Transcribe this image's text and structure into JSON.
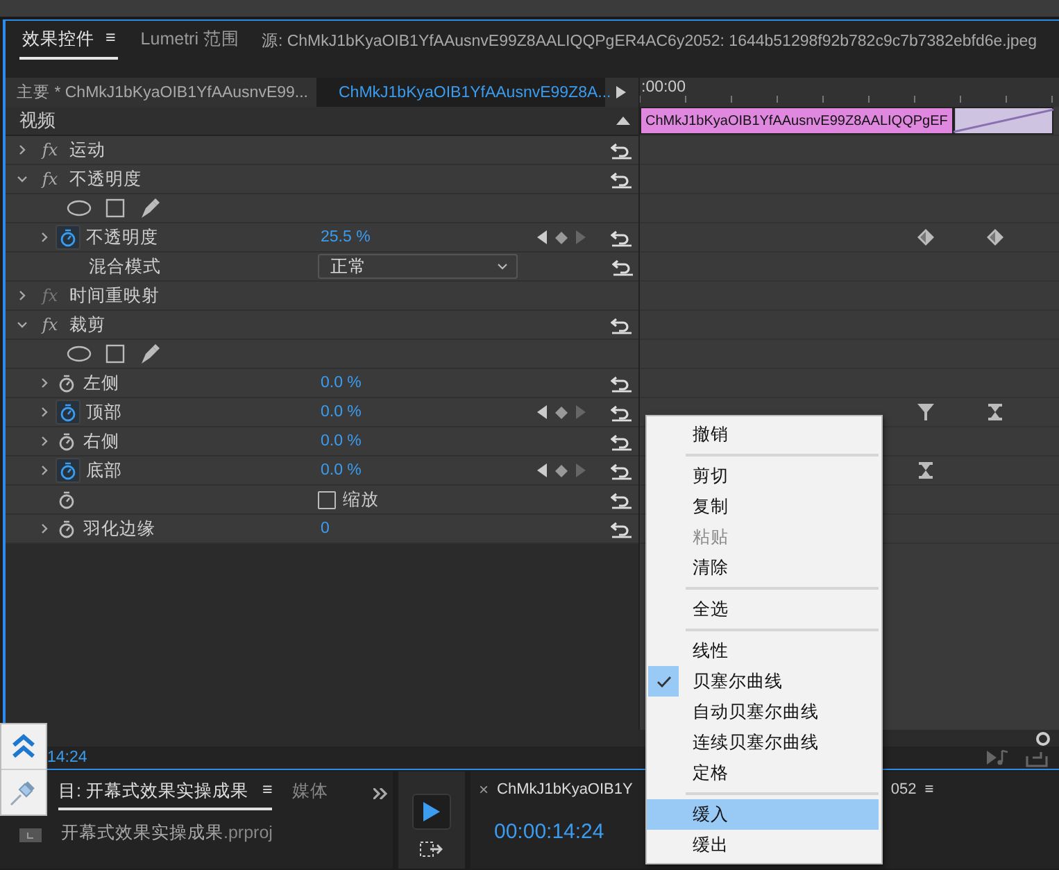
{
  "tabs": [
    {
      "label": "效果控件",
      "selected": true,
      "menu": "≡"
    },
    {
      "label": "Lumetri 范围",
      "selected": false
    }
  ],
  "source_label": "源: ChMkJ1bKyaOIB1YfAAusnvE99Z8AALIQQPgER4AC6y2052: 1644b51298f92b782c9c7b7382ebfd6e.jpeg",
  "master_label": "主要 * ChMkJ1bKyaOIB1YfAAusnvE99...",
  "clip_selector": "ChMkJ1bKyaOIB1YfAAusnvE99Z8A...",
  "ruler_time": ":00:00",
  "section": "视频",
  "timeline_clip": "ChMkJ1bKyaOIB1YfAAusnvE99Z8AALIQQPgEF",
  "rows": [
    {
      "kind": "effect",
      "icon": "fx",
      "label": "运动",
      "expanded": false,
      "fx_enabled": true,
      "reset": true
    },
    {
      "kind": "effect",
      "icon": "fx",
      "label": "不透明度",
      "expanded": true,
      "fx_enabled": true,
      "reset": true
    },
    {
      "kind": "masks"
    },
    {
      "kind": "param",
      "label": "不透明度",
      "value": "25.5 %",
      "expandable": true,
      "animated": true,
      "keyframe_nav": true,
      "reset": true,
      "keyframes": [
        {
          "kind": "bezier"
        },
        {
          "kind": "bezier"
        }
      ]
    },
    {
      "kind": "select",
      "label": "混合模式",
      "value": "正常",
      "reset": true
    },
    {
      "kind": "effect",
      "icon": "fx",
      "label": "时间重映射",
      "expanded": false,
      "fx_enabled": false,
      "reset": false
    },
    {
      "kind": "effect",
      "icon": "fx",
      "label": "裁剪",
      "expanded": true,
      "fx_enabled": true,
      "reset": true
    },
    {
      "kind": "masks"
    },
    {
      "kind": "param",
      "label": "左侧",
      "value": "0.0 %",
      "expandable": true,
      "animated": false,
      "keyframe_nav": false,
      "reset": true,
      "keyframes": []
    },
    {
      "kind": "param",
      "label": "顶部",
      "value": "0.0 %",
      "expandable": true,
      "animated": true,
      "keyframe_nav": true,
      "reset": true,
      "keyframes": [
        {
          "kind": "ease_in"
        },
        {
          "kind": "hold"
        }
      ]
    },
    {
      "kind": "param",
      "label": "右侧",
      "value": "0.0 %",
      "expandable": true,
      "animated": false,
      "keyframe_nav": false,
      "reset": true,
      "keyframes": []
    },
    {
      "kind": "param",
      "label": "底部",
      "value": "0.0 %",
      "expandable": true,
      "animated": true,
      "keyframe_nav": true,
      "reset": true,
      "keyframes": [
        {
          "kind": "hold"
        }
      ]
    },
    {
      "kind": "checkbox",
      "label": "缩放",
      "checked": false,
      "reset": true
    },
    {
      "kind": "param",
      "label": "羽化边缘",
      "value": "0",
      "expandable": true,
      "animated": false,
      "keyframe_nav": false,
      "reset": true,
      "keyframes": []
    }
  ],
  "footer_time": "14:24",
  "context_menu": [
    {
      "kind": "item",
      "label": "撤销",
      "checked": false,
      "disabled": false,
      "selected": false
    },
    {
      "kind": "separator"
    },
    {
      "kind": "item",
      "label": "剪切",
      "checked": false,
      "disabled": false,
      "selected": false
    },
    {
      "kind": "item",
      "label": "复制",
      "checked": false,
      "disabled": false,
      "selected": false
    },
    {
      "kind": "item",
      "label": "粘贴",
      "checked": false,
      "disabled": true,
      "selected": false
    },
    {
      "kind": "item",
      "label": "清除",
      "checked": false,
      "disabled": false,
      "selected": false
    },
    {
      "kind": "separator"
    },
    {
      "kind": "item",
      "label": "全选",
      "checked": false,
      "disabled": false,
      "selected": false
    },
    {
      "kind": "separator"
    },
    {
      "kind": "item",
      "label": "线性",
      "checked": false,
      "disabled": false,
      "selected": false
    },
    {
      "kind": "item",
      "label": "贝塞尔曲线",
      "checked": true,
      "disabled": false,
      "selected": false
    },
    {
      "kind": "item",
      "label": "自动贝塞尔曲线",
      "checked": false,
      "disabled": false,
      "selected": false
    },
    {
      "kind": "item",
      "label": "连续贝塞尔曲线",
      "checked": false,
      "disabled": false,
      "selected": false
    },
    {
      "kind": "item",
      "label": "定格",
      "checked": false,
      "disabled": false,
      "selected": false
    },
    {
      "kind": "separator"
    },
    {
      "kind": "item",
      "label": "缓入",
      "checked": false,
      "disabled": false,
      "selected": true
    },
    {
      "kind": "item",
      "label": "缓出",
      "checked": false,
      "disabled": false,
      "selected": false
    }
  ],
  "project_panel": {
    "tabs": [
      {
        "label": "目: 开幕式效果实操成果",
        "selected": true,
        "menu": "≡"
      },
      {
        "label": "媒体",
        "selected": false
      }
    ],
    "file_name": "开幕式效果实操成果",
    "file_ext": ".prproj"
  },
  "program_panel": {
    "close": "×",
    "tab_label": "ChMkJ1bKyaOIB1Y",
    "tab_tail": "052",
    "menu": "≡",
    "timecode": "00:00:14:24"
  }
}
